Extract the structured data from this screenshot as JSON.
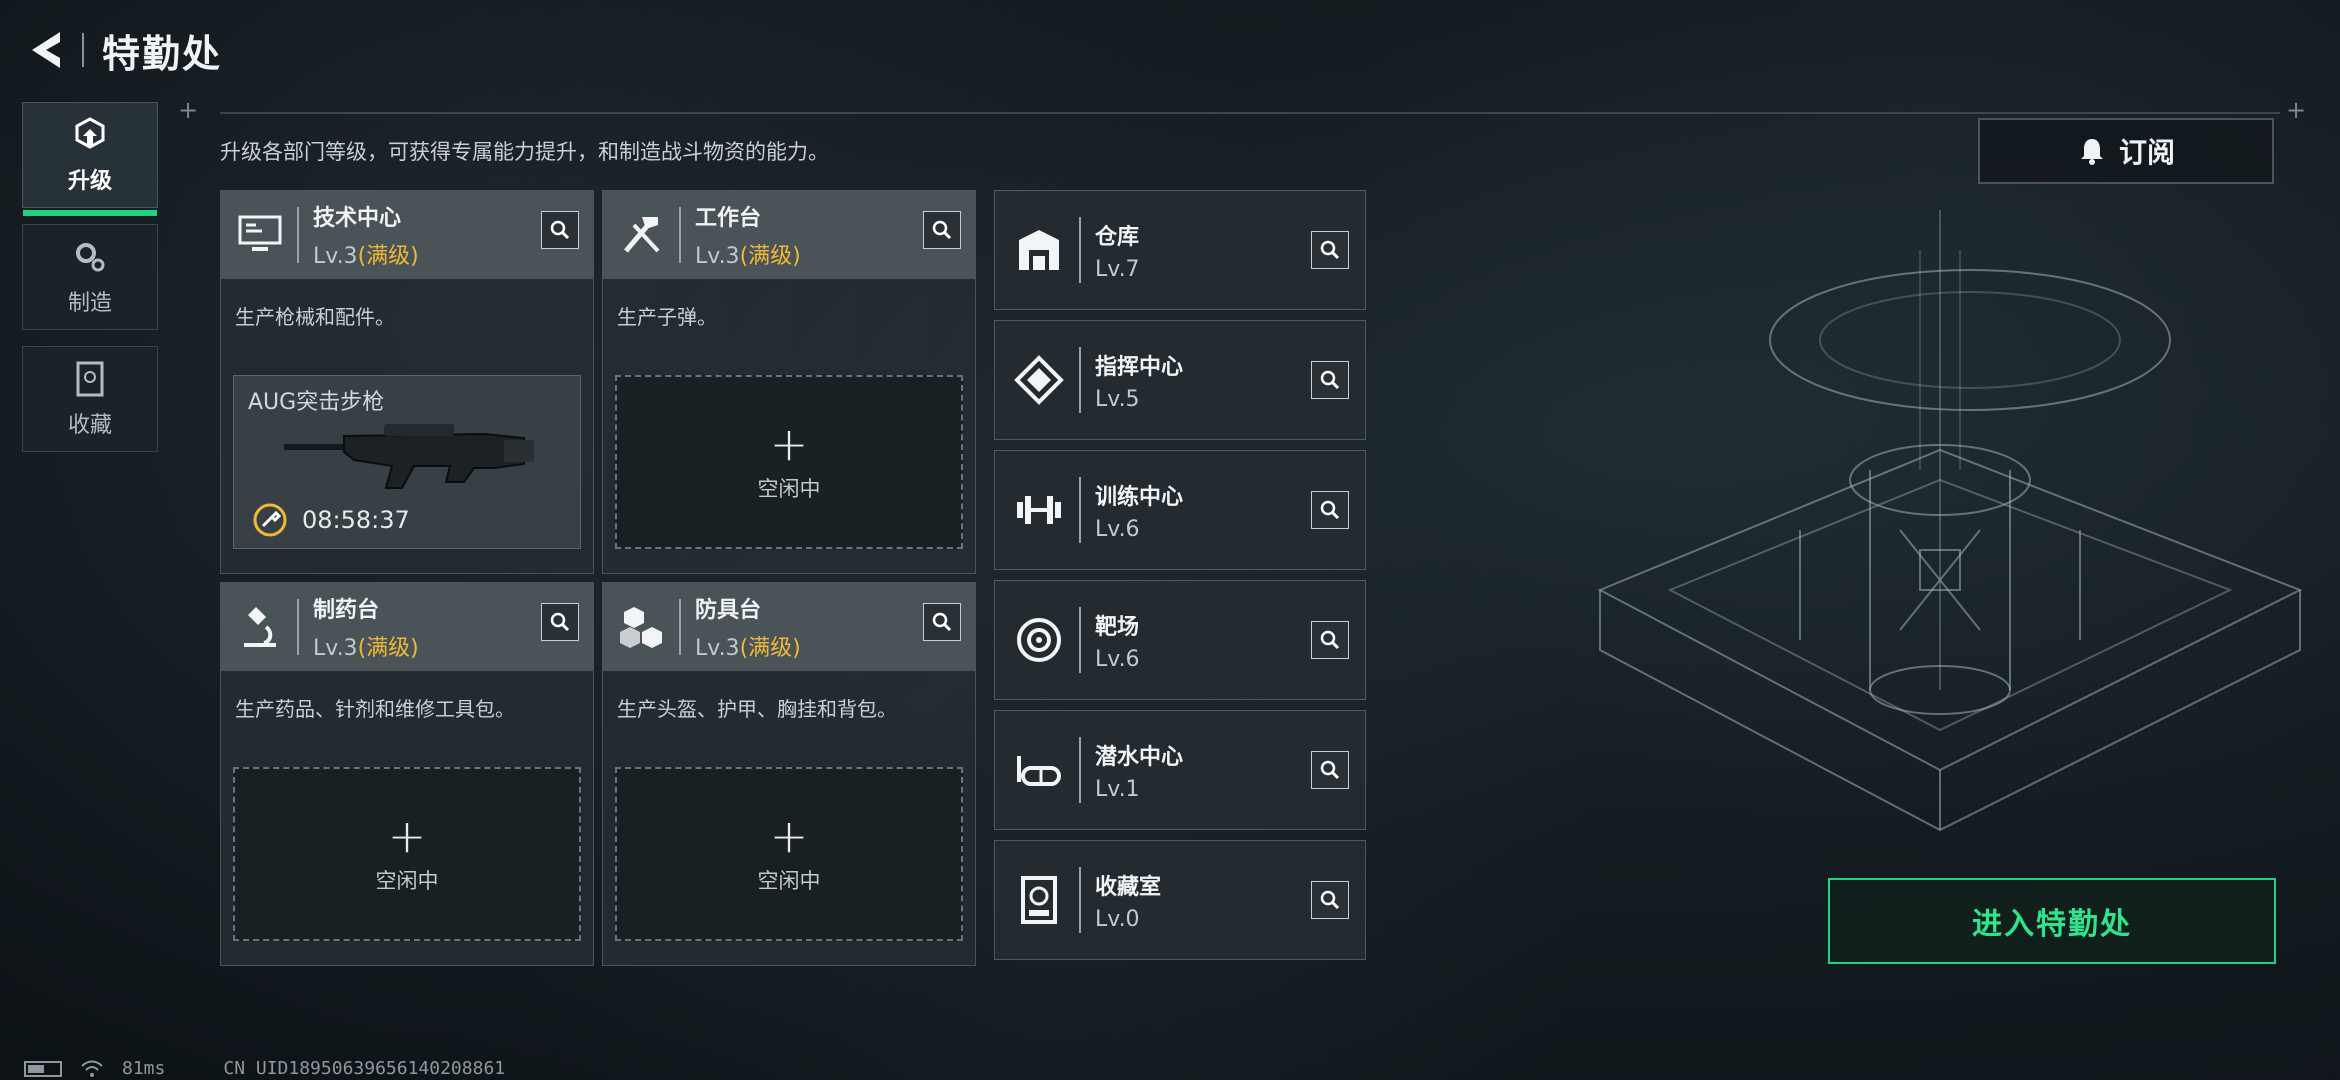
{
  "header": {
    "title": "特勤处"
  },
  "side_tabs": [
    {
      "label": "升级",
      "icon": "upgrade-icon",
      "active": true
    },
    {
      "label": "制造",
      "icon": "gears-icon",
      "active": false
    },
    {
      "label": "收藏",
      "icon": "collection-icon",
      "active": false
    }
  ],
  "description": "升级各部门等级，可获得专属能力提升，和制造战斗物资的能力。",
  "subscribe_label": "订阅",
  "big_cards": [
    {
      "name": "技术中心",
      "level": "Lv.3",
      "max": "(满级)",
      "desc": "生产枪械和配件。",
      "icon": "monitor-icon",
      "crafting": {
        "item": "AUG突击步枪",
        "timer": "08:58:37"
      }
    },
    {
      "name": "工作台",
      "level": "Lv.3",
      "max": "(满级)",
      "desc": "生产子弹。",
      "icon": "hammer-wrench-icon",
      "slot": "空闲中"
    },
    {
      "name": "制药台",
      "level": "Lv.3",
      "max": "(满级)",
      "desc": "生产药品、针剂和维修工具包。",
      "icon": "microscope-icon",
      "slot": "空闲中"
    },
    {
      "name": "防具台",
      "level": "Lv.3",
      "max": "(满级)",
      "desc": "生产头盔、护甲、胸挂和背包。",
      "icon": "boxes-icon",
      "slot": "空闲中"
    }
  ],
  "small_cards": [
    {
      "name": "仓库",
      "level": "Lv.7",
      "icon": "warehouse-icon"
    },
    {
      "name": "指挥中心",
      "level": "Lv.5",
      "icon": "command-icon"
    },
    {
      "name": "训练中心",
      "level": "Lv.6",
      "icon": "dumbbell-icon"
    },
    {
      "name": "靶场",
      "level": "Lv.6",
      "icon": "target-icon"
    },
    {
      "name": "潜水中心",
      "level": "Lv.1",
      "icon": "diving-mask-icon"
    },
    {
      "name": "收藏室",
      "level": "Lv.0",
      "icon": "vault-icon"
    }
  ],
  "enter_label": "进入特勤处",
  "status": {
    "ping": "81ms",
    "uid": "CN UID18950639656140208861"
  },
  "colors": {
    "accent": "#1ed381",
    "max_level": "#f0b935"
  }
}
